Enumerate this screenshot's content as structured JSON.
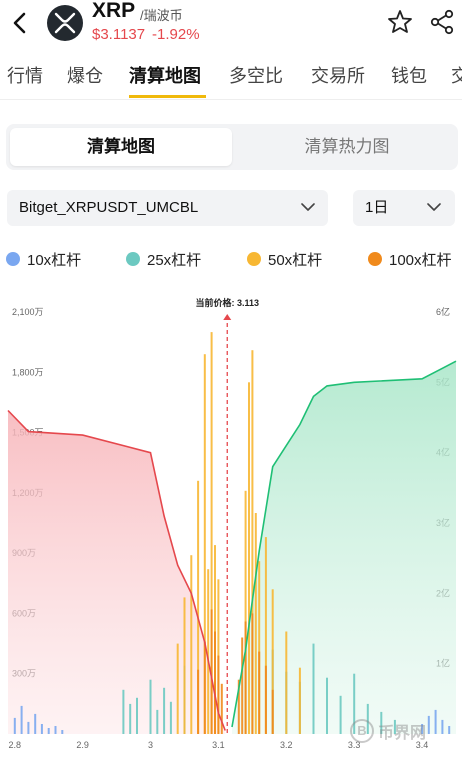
{
  "header": {
    "coin_name": "XRP",
    "coin_cn": "/瑞波币",
    "price": "$3.1137",
    "change": "-1.92%",
    "colors": {
      "down": "#e5484d",
      "accent": "#f0b90b"
    }
  },
  "tabs": [
    {
      "label": "行情"
    },
    {
      "label": "爆仓"
    },
    {
      "label": "清算地图"
    },
    {
      "label": "多空比"
    },
    {
      "label": "交易所"
    },
    {
      "label": "钱包"
    },
    {
      "label": "交"
    }
  ],
  "segmented": {
    "active": "清算地图",
    "other": "清算热力图"
  },
  "filters": {
    "pair": "Bitget_XRPUSDT_UMCBL",
    "period": "1日"
  },
  "legend": [
    {
      "label": "10x杠杆",
      "color": "#7aa7f0"
    },
    {
      "label": "25x杠杆",
      "color": "#6cc9c1"
    },
    {
      "label": "50x杠杆",
      "color": "#f7b733"
    },
    {
      "label": "100x杠杆",
      "color": "#f08a1c"
    }
  ],
  "watermark": {
    "symbol": "B",
    "text": "币界网"
  },
  "chart_data": {
    "type": "bar",
    "current_price_label": "当前价格: 3.113",
    "current_price": 3.113,
    "x_ticks": [
      "2.8",
      "2.9",
      "3",
      "3.1",
      "3.2",
      "3.3",
      "3.4"
    ],
    "xlim": [
      2.79,
      3.45
    ],
    "y_left_ticks": [
      "300万",
      "600万",
      "900万",
      "1,200万",
      "1,500万",
      "1,800万",
      "2,100万"
    ],
    "ylim_left": [
      0,
      21000000
    ],
    "y_right_ticks": [
      "1亿",
      "2亿",
      "3亿",
      "4亿",
      "5亿",
      "6亿"
    ],
    "ylim_right": [
      0,
      600000000
    ],
    "series": [
      {
        "name": "10x杠杆",
        "color": "#7aa7f0",
        "x": [
          2.8,
          2.81,
          2.82,
          2.83,
          2.84,
          2.85,
          2.86,
          2.87,
          3.4,
          3.41,
          3.42,
          3.43,
          3.44
        ],
        "values": [
          800000,
          1400000,
          600000,
          1000000,
          500000,
          300000,
          400000,
          200000,
          500000,
          900000,
          1200000,
          700000,
          400000
        ]
      },
      {
        "name": "25x杠杆",
        "color": "#6cc9c1",
        "x": [
          2.96,
          2.97,
          2.98,
          3.0,
          3.01,
          3.02,
          3.03,
          3.05,
          3.18,
          3.2,
          3.22,
          3.24,
          3.26,
          3.28,
          3.3,
          3.32,
          3.34,
          3.36
        ],
        "values": [
          2200000,
          1500000,
          1800000,
          2700000,
          1200000,
          2300000,
          1600000,
          3400000,
          4200000,
          3100000,
          2600000,
          4500000,
          2800000,
          1900000,
          3000000,
          1500000,
          1100000,
          700000
        ]
      },
      {
        "name": "50x杠杆",
        "color": "#f7b733",
        "x": [
          3.04,
          3.05,
          3.06,
          3.07,
          3.08,
          3.085,
          3.09,
          3.095,
          3.1,
          3.14,
          3.145,
          3.15,
          3.155,
          3.16,
          3.17,
          3.18,
          3.2,
          3.22
        ],
        "values": [
          4500000,
          6800000,
          8900000,
          12600000,
          18900000,
          8200000,
          20000000,
          9400000,
          7700000,
          12100000,
          17500000,
          19100000,
          11000000,
          8600000,
          9800000,
          7200000,
          5100000,
          3300000
        ]
      },
      {
        "name": "100x杠杆",
        "color": "#f08a1c",
        "x": [
          3.07,
          3.08,
          3.09,
          3.095,
          3.1,
          3.105,
          3.13,
          3.135,
          3.14,
          3.15,
          3.16,
          3.17,
          3.18
        ],
        "values": [
          3200000,
          4600000,
          6200000,
          5100000,
          3900000,
          2500000,
          2700000,
          4800000,
          5600000,
          6000000,
          4100000,
          3400000,
          2200000
        ]
      }
    ],
    "cumulative_short": {
      "name": "",
      "color": "#e5484d",
      "x": [
        2.79,
        2.82,
        2.9,
        3.0,
        3.02,
        3.04,
        3.06,
        3.08,
        3.1,
        3.11
      ],
      "values": [
        460000000,
        430000000,
        425000000,
        400000000,
        310000000,
        240000000,
        200000000,
        130000000,
        30000000,
        5000000
      ]
    },
    "cumulative_long": {
      "name": "",
      "color": "#1fbf75",
      "x": [
        3.12,
        3.14,
        3.16,
        3.18,
        3.2,
        3.22,
        3.24,
        3.26,
        3.3,
        3.4,
        3.43,
        3.45
      ],
      "values": [
        10000000,
        120000000,
        260000000,
        380000000,
        410000000,
        440000000,
        480000000,
        495000000,
        500000000,
        505000000,
        520000000,
        530000000
      ]
    },
    "grid": false
  }
}
